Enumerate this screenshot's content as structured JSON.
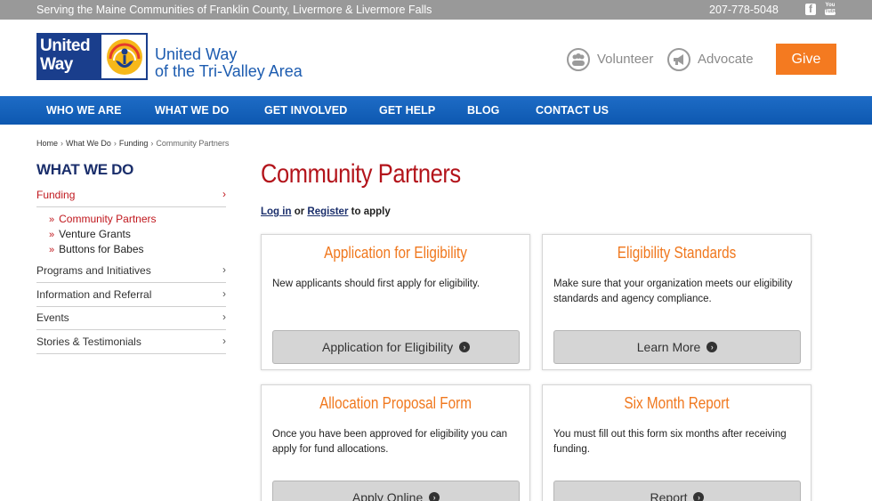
{
  "topbar": {
    "tagline": "Serving the Maine Communities of Franklin County, Livermore & Livermore Falls",
    "phone": "207-778-5048",
    "facebook_glyph": "f",
    "youtube_you": "You",
    "youtube_tube": "Tube"
  },
  "header": {
    "logo_line1": "United",
    "logo_line2": "Way",
    "org_line1": "United Way",
    "org_line2": "of the Tri-Valley Area",
    "volunteer_label": "Volunteer",
    "advocate_label": "Advocate",
    "give_label": "Give"
  },
  "nav": {
    "items": [
      {
        "label": "WHO WE ARE"
      },
      {
        "label": "WHAT WE DO"
      },
      {
        "label": "GET INVOLVED"
      },
      {
        "label": "GET HELP"
      },
      {
        "label": "BLOG"
      },
      {
        "label": "CONTACT US"
      }
    ]
  },
  "breadcrumb": {
    "items": [
      "Home",
      "What We Do",
      "Funding",
      "Community Partners"
    ],
    "sep": "›"
  },
  "sidebar": {
    "title": "WHAT WE DO",
    "chevron": "›",
    "bullet": "»",
    "funding": "Funding",
    "sub_items": [
      "Community Partners",
      "Venture Grants",
      "Buttons for Babes"
    ],
    "items": [
      "Programs and Initiatives",
      "Information and Referral",
      "Events",
      "Stories & Testimonials"
    ]
  },
  "main": {
    "title": "Community Partners",
    "login": "Log in",
    "or": "or",
    "register": "Register",
    "to_apply": "to apply",
    "cards": [
      {
        "title": "Application for Eligibility",
        "desc": "New applicants should first apply for eligibility.",
        "button": "Application for Eligibility"
      },
      {
        "title": "Eligibility Standards",
        "desc": "Make sure that your organization meets our eligibility standards and agency compliance.",
        "button": "Learn More"
      },
      {
        "title": "Allocation Proposal Form",
        "desc": "Once you have been approved for eligibility you can apply for fund allocations.",
        "button": "Apply Online"
      },
      {
        "title": "Six Month Report",
        "desc": "You must fill out this form six months after receiving funding.",
        "button": "Report"
      }
    ],
    "button_arrow": "›"
  },
  "colors": {
    "brand_blue": "#1a3e8c",
    "nav_blue": "#1e6cc6",
    "accent_red": "#b3141b",
    "accent_orange": "#f47a20",
    "topbar_gray": "#999999"
  }
}
